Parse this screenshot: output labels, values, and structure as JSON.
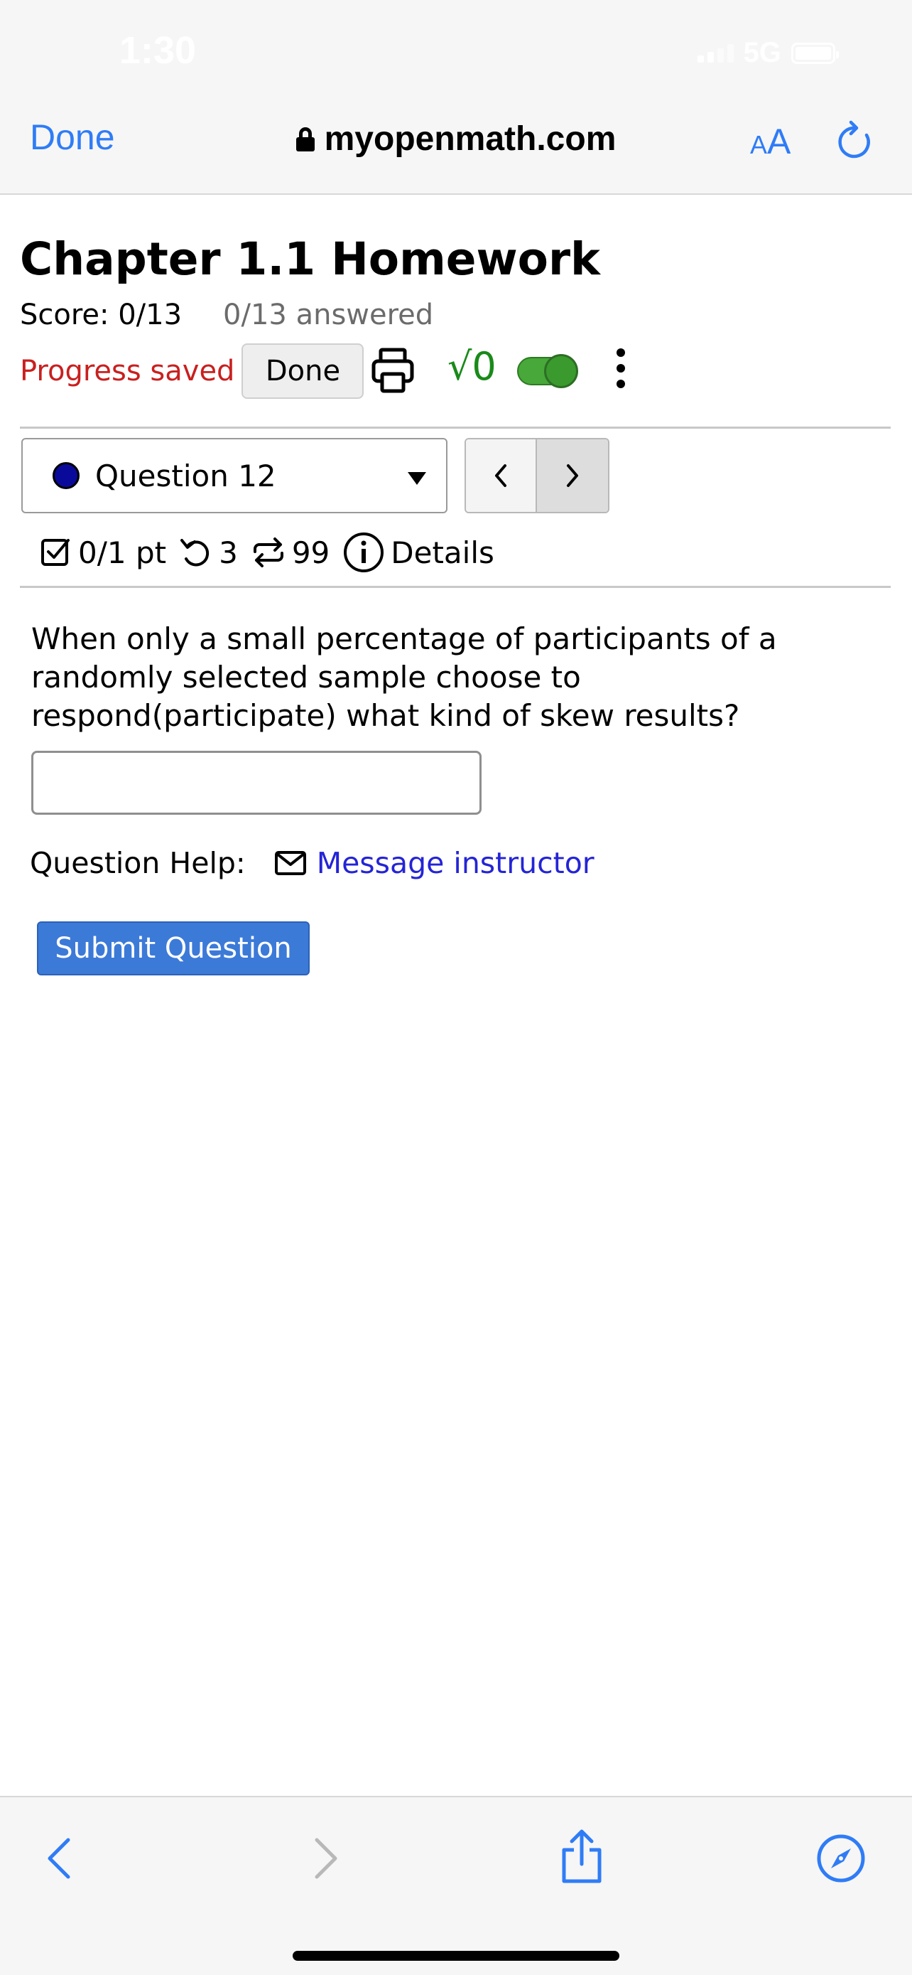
{
  "status_bar": {
    "time": "1:30",
    "network": "5G"
  },
  "browser": {
    "done_label": "Done",
    "url": "myopenmath.com",
    "text_size_label_small": "A",
    "text_size_label_big": "A"
  },
  "assignment": {
    "title": "Chapter 1.1 Homework",
    "score": "Score: 0/13",
    "answered": "0/13 answered",
    "progress_status": "Progress saved",
    "done_button": "Done"
  },
  "question_nav": {
    "selected_question": "Question 12"
  },
  "question_meta": {
    "points": "0/1 pt",
    "retries": "3",
    "regenerations": "99",
    "details_label": "Details"
  },
  "question": {
    "text": "When only a small percentage of participants of a randomly selected sample choose to respond(participate) what kind of skew results?",
    "answer_value": "",
    "help_label": "Question Help:",
    "message_link": "Message instructor",
    "submit_label": "Submit Question"
  },
  "colors": {
    "link_blue": "#2f7cf6",
    "progress_red": "#c8201f",
    "submit_blue": "#3c7ad8",
    "toggle_green": "#48a83a"
  }
}
